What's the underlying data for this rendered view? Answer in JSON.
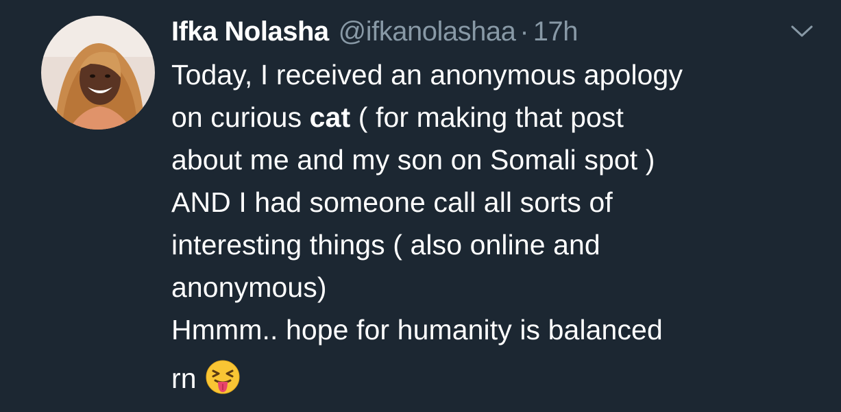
{
  "tweet": {
    "display_name": "Ifka Nolasha",
    "handle": "@ifkanolashaa",
    "separator": "·",
    "time": "17h",
    "lines": [
      {
        "pre": "Today, I received an anonymous apology"
      },
      {
        "pre": "on curious ",
        "bold": "cat",
        "post": " ( for making that post"
      },
      {
        "pre": "about me and my son on Somali spot )"
      },
      {
        "pre": "AND I had someone call all sorts of"
      },
      {
        "pre": "interesting things ( also online and"
      },
      {
        "pre": "anonymous)"
      },
      {
        "pre": "Hmmm.. hope for humanity is balanced"
      },
      {
        "pre": "rn"
      }
    ],
    "emoji": "squinting-face-with-tongue"
  },
  "colors": {
    "background": "#1c2732",
    "text": "#ffffff",
    "secondary_text": "#8899a6",
    "emoji_face": "#f9c534"
  },
  "icons": {
    "menu": "chevron-down-icon",
    "avatar": "profile-photo"
  }
}
